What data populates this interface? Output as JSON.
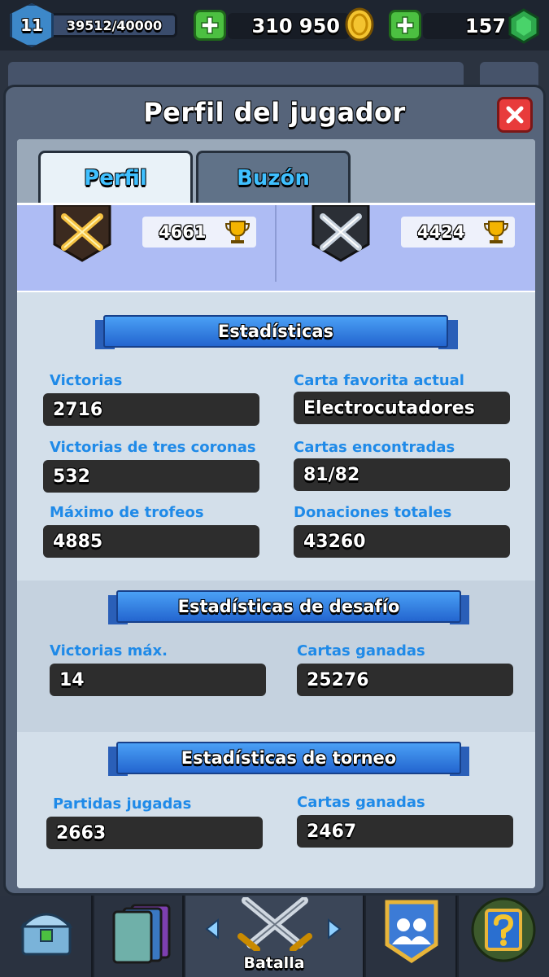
{
  "topbar": {
    "level": "11",
    "experience": "39512/40000",
    "gold": "310 950",
    "gems": "157",
    "colors": {
      "gold": "#f4c430",
      "gems": "#2ea84c",
      "plus": "#4cc041"
    }
  },
  "modal": {
    "title": "Perfil del jugador",
    "close_icon": "close-x-icon"
  },
  "tabs": [
    {
      "label": "Perfil",
      "selected": true
    },
    {
      "label": "Buzón",
      "selected": false
    }
  ],
  "trophies": {
    "current": "4661",
    "best": "4424"
  },
  "stats": {
    "title": "Estadísticas",
    "items": [
      {
        "label": "Victorias",
        "value": "2716"
      },
      {
        "label": "Carta favorita actual",
        "value": "Electrocutadores"
      },
      {
        "label": "Victorias de tres coronas",
        "value": "532"
      },
      {
        "label": "Cartas encontradas",
        "value": "81/82"
      },
      {
        "label": "Máximo de trofeos",
        "value": "4885"
      },
      {
        "label": "Donaciones totales",
        "value": "43260"
      }
    ]
  },
  "challenge_stats": {
    "title": "Estadísticas de desafío",
    "items": [
      {
        "label": "Victorias máx.",
        "value": "14"
      },
      {
        "label": "Cartas ganadas",
        "value": "25276"
      }
    ]
  },
  "tournament_stats": {
    "title": "Estadísticas de torneo",
    "items": [
      {
        "label": "Partidas jugadas",
        "value": "2663"
      },
      {
        "label": "Cartas ganadas",
        "value": "2467"
      }
    ]
  },
  "bottom_nav": {
    "active": "Batalla",
    "items": [
      "shop-icon",
      "cards-icon",
      "battle-icon",
      "clan-icon",
      "events-icon"
    ]
  }
}
